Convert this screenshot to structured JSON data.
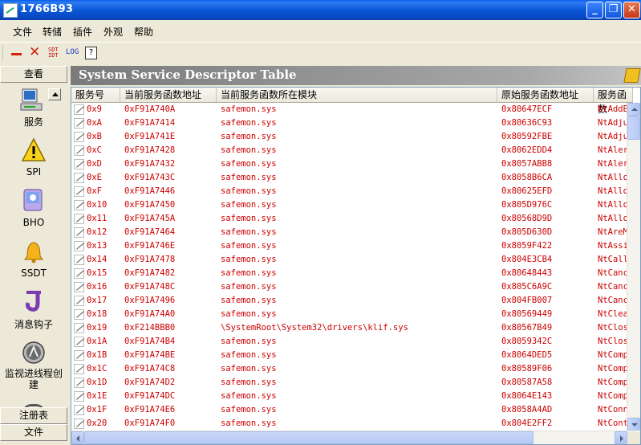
{
  "window": {
    "title": "1766B93"
  },
  "menu": [
    "文件",
    "转储",
    "插件",
    "外观",
    "帮助"
  ],
  "toolbar": {
    "sdt_top": "SDT",
    "sdt_bottom": "IDT",
    "log": "LOG",
    "help": "?"
  },
  "sidebar": {
    "header": "查看",
    "items": [
      "服务",
      "SPI",
      "BHO",
      "SSDT",
      "消息钩子",
      "监视进线程创建"
    ],
    "footer_buttons": [
      "注册表",
      "文件"
    ]
  },
  "panel": {
    "title": "System Service Descriptor Table"
  },
  "table": {
    "columns": [
      "服务号",
      "当前服务函数地址",
      "当前服务函数所在模块",
      "原始服务函数地址",
      "服务函数"
    ],
    "rows": [
      [
        "0x9",
        "0xF91A740A",
        "safemon.sys",
        "0x80647ECF",
        "NtAddB"
      ],
      [
        "0xA",
        "0xF91A7414",
        "safemon.sys",
        "0x80636C93",
        "NtAdju"
      ],
      [
        "0xB",
        "0xF91A741E",
        "safemon.sys",
        "0x80592FBE",
        "NtAdju"
      ],
      [
        "0xC",
        "0xF91A7428",
        "safemon.sys",
        "0x8062EDD4",
        "NtAler"
      ],
      [
        "0xD",
        "0xF91A7432",
        "safemon.sys",
        "0x8057ABB8",
        "NtAler"
      ],
      [
        "0xE",
        "0xF91A743C",
        "safemon.sys",
        "0x8058B6CA",
        "NtAllo"
      ],
      [
        "0xF",
        "0xF91A7446",
        "safemon.sys",
        "0x80625EFD",
        "NtAllo"
      ],
      [
        "0x10",
        "0xF91A7450",
        "safemon.sys",
        "0x805D976C",
        "NtAllo"
      ],
      [
        "0x11",
        "0xF91A745A",
        "safemon.sys",
        "0x80568D9D",
        "NtAllo"
      ],
      [
        "0x12",
        "0xF91A7464",
        "safemon.sys",
        "0x805D630D",
        "NtAreM"
      ],
      [
        "0x13",
        "0xF91A746E",
        "safemon.sys",
        "0x8059F422",
        "NtAssi"
      ],
      [
        "0x14",
        "0xF91A7478",
        "safemon.sys",
        "0x804E3CB4",
        "NtCall"
      ],
      [
        "0x15",
        "0xF91A7482",
        "safemon.sys",
        "0x80648443",
        "NtCanc"
      ],
      [
        "0x16",
        "0xF91A748C",
        "safemon.sys",
        "0x805C6A9C",
        "NtCanc"
      ],
      [
        "0x17",
        "0xF91A7496",
        "safemon.sys",
        "0x804FB007",
        "NtCanc"
      ],
      [
        "0x18",
        "0xF91A74A0",
        "safemon.sys",
        "0x80569449",
        "NtClea"
      ],
      [
        "0x19",
        "0xF214BBB0",
        "\\SystemRoot\\System32\\drivers\\klif.sys",
        "0x80567B49",
        "NtClos"
      ],
      [
        "0x1A",
        "0xF91A74B4",
        "safemon.sys",
        "0x8059342C",
        "NtClos"
      ],
      [
        "0x1B",
        "0xF91A74BE",
        "safemon.sys",
        "0x8064DED5",
        "NtComp"
      ],
      [
        "0x1C",
        "0xF91A74C8",
        "safemon.sys",
        "0x80589F06",
        "NtComp"
      ],
      [
        "0x1D",
        "0xF91A74D2",
        "safemon.sys",
        "0x80587A58",
        "NtComp"
      ],
      [
        "0x1E",
        "0xF91A74DC",
        "safemon.sys",
        "0x8064E143",
        "NtComp"
      ],
      [
        "0x1F",
        "0xF91A74E6",
        "safemon.sys",
        "0x8058A4AD",
        "NtConn"
      ],
      [
        "0x20",
        "0xF91A74F0",
        "safemon.sys",
        "0x804E2FF2",
        "NtCont"
      ]
    ]
  }
}
